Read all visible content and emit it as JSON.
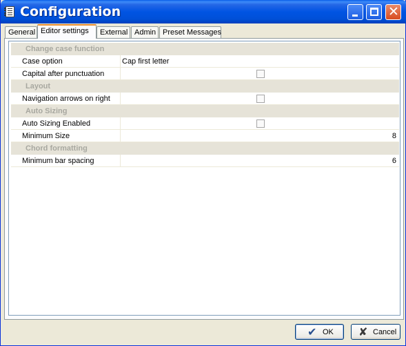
{
  "window": {
    "title": "Configuration"
  },
  "tabs": [
    {
      "label": "General"
    },
    {
      "label": "Editor settings",
      "active": true
    },
    {
      "label": "External"
    },
    {
      "label": "Admin"
    },
    {
      "label": "Preset Messages"
    }
  ],
  "settings": {
    "change_case": {
      "header": "Change case function",
      "case_option": {
        "label": "Case option",
        "value": "Cap first letter"
      },
      "capital_after_punctuation": {
        "label": "Capital after punctuation",
        "checked": false
      }
    },
    "layout": {
      "header": "Layout",
      "navigation_arrows_on_right": {
        "label": "Navigation arrows on right",
        "checked": false
      }
    },
    "auto_sizing": {
      "header": "Auto Sizing",
      "enabled": {
        "label": "Auto Sizing Enabled",
        "checked": false
      },
      "minimum_size": {
        "label": "Minimum Size",
        "value": "8"
      }
    },
    "chord_formatting": {
      "header": "Chord formatting",
      "minimum_bar_spacing": {
        "label": "Minimum bar spacing",
        "value": "6"
      }
    }
  },
  "buttons": {
    "ok": "OK",
    "cancel": "Cancel"
  },
  "colors": {
    "titlebar": "#0054e3",
    "active_tab_accent": "#e68b2c",
    "section_bg": "#e6e3d8"
  }
}
